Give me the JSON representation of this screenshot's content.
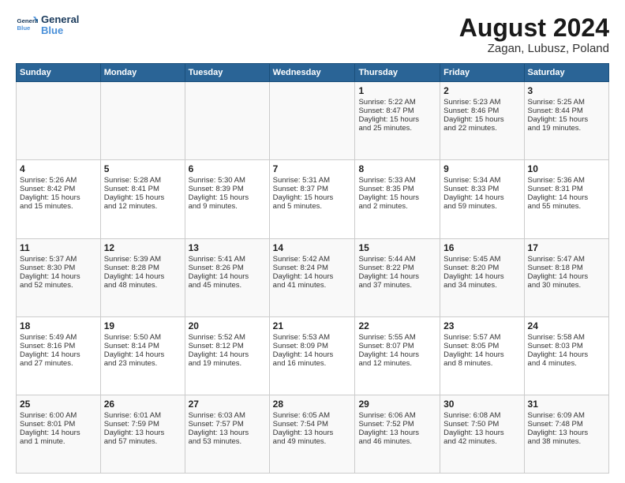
{
  "logo": {
    "line1": "General",
    "line2": "Blue"
  },
  "title": "August 2024",
  "subtitle": "Zagan, Lubusz, Poland",
  "header_days": [
    "Sunday",
    "Monday",
    "Tuesday",
    "Wednesday",
    "Thursday",
    "Friday",
    "Saturday"
  ],
  "weeks": [
    [
      {
        "day": "",
        "info": ""
      },
      {
        "day": "",
        "info": ""
      },
      {
        "day": "",
        "info": ""
      },
      {
        "day": "",
        "info": ""
      },
      {
        "day": "1",
        "info": "Sunrise: 5:22 AM\nSunset: 8:47 PM\nDaylight: 15 hours\nand 25 minutes."
      },
      {
        "day": "2",
        "info": "Sunrise: 5:23 AM\nSunset: 8:46 PM\nDaylight: 15 hours\nand 22 minutes."
      },
      {
        "day": "3",
        "info": "Sunrise: 5:25 AM\nSunset: 8:44 PM\nDaylight: 15 hours\nand 19 minutes."
      }
    ],
    [
      {
        "day": "4",
        "info": "Sunrise: 5:26 AM\nSunset: 8:42 PM\nDaylight: 15 hours\nand 15 minutes."
      },
      {
        "day": "5",
        "info": "Sunrise: 5:28 AM\nSunset: 8:41 PM\nDaylight: 15 hours\nand 12 minutes."
      },
      {
        "day": "6",
        "info": "Sunrise: 5:30 AM\nSunset: 8:39 PM\nDaylight: 15 hours\nand 9 minutes."
      },
      {
        "day": "7",
        "info": "Sunrise: 5:31 AM\nSunset: 8:37 PM\nDaylight: 15 hours\nand 5 minutes."
      },
      {
        "day": "8",
        "info": "Sunrise: 5:33 AM\nSunset: 8:35 PM\nDaylight: 15 hours\nand 2 minutes."
      },
      {
        "day": "9",
        "info": "Sunrise: 5:34 AM\nSunset: 8:33 PM\nDaylight: 14 hours\nand 59 minutes."
      },
      {
        "day": "10",
        "info": "Sunrise: 5:36 AM\nSunset: 8:31 PM\nDaylight: 14 hours\nand 55 minutes."
      }
    ],
    [
      {
        "day": "11",
        "info": "Sunrise: 5:37 AM\nSunset: 8:30 PM\nDaylight: 14 hours\nand 52 minutes."
      },
      {
        "day": "12",
        "info": "Sunrise: 5:39 AM\nSunset: 8:28 PM\nDaylight: 14 hours\nand 48 minutes."
      },
      {
        "day": "13",
        "info": "Sunrise: 5:41 AM\nSunset: 8:26 PM\nDaylight: 14 hours\nand 45 minutes."
      },
      {
        "day": "14",
        "info": "Sunrise: 5:42 AM\nSunset: 8:24 PM\nDaylight: 14 hours\nand 41 minutes."
      },
      {
        "day": "15",
        "info": "Sunrise: 5:44 AM\nSunset: 8:22 PM\nDaylight: 14 hours\nand 37 minutes."
      },
      {
        "day": "16",
        "info": "Sunrise: 5:45 AM\nSunset: 8:20 PM\nDaylight: 14 hours\nand 34 minutes."
      },
      {
        "day": "17",
        "info": "Sunrise: 5:47 AM\nSunset: 8:18 PM\nDaylight: 14 hours\nand 30 minutes."
      }
    ],
    [
      {
        "day": "18",
        "info": "Sunrise: 5:49 AM\nSunset: 8:16 PM\nDaylight: 14 hours\nand 27 minutes."
      },
      {
        "day": "19",
        "info": "Sunrise: 5:50 AM\nSunset: 8:14 PM\nDaylight: 14 hours\nand 23 minutes."
      },
      {
        "day": "20",
        "info": "Sunrise: 5:52 AM\nSunset: 8:12 PM\nDaylight: 14 hours\nand 19 minutes."
      },
      {
        "day": "21",
        "info": "Sunrise: 5:53 AM\nSunset: 8:09 PM\nDaylight: 14 hours\nand 16 minutes."
      },
      {
        "day": "22",
        "info": "Sunrise: 5:55 AM\nSunset: 8:07 PM\nDaylight: 14 hours\nand 12 minutes."
      },
      {
        "day": "23",
        "info": "Sunrise: 5:57 AM\nSunset: 8:05 PM\nDaylight: 14 hours\nand 8 minutes."
      },
      {
        "day": "24",
        "info": "Sunrise: 5:58 AM\nSunset: 8:03 PM\nDaylight: 14 hours\nand 4 minutes."
      }
    ],
    [
      {
        "day": "25",
        "info": "Sunrise: 6:00 AM\nSunset: 8:01 PM\nDaylight: 14 hours\nand 1 minute."
      },
      {
        "day": "26",
        "info": "Sunrise: 6:01 AM\nSunset: 7:59 PM\nDaylight: 13 hours\nand 57 minutes."
      },
      {
        "day": "27",
        "info": "Sunrise: 6:03 AM\nSunset: 7:57 PM\nDaylight: 13 hours\nand 53 minutes."
      },
      {
        "day": "28",
        "info": "Sunrise: 6:05 AM\nSunset: 7:54 PM\nDaylight: 13 hours\nand 49 minutes."
      },
      {
        "day": "29",
        "info": "Sunrise: 6:06 AM\nSunset: 7:52 PM\nDaylight: 13 hours\nand 46 minutes."
      },
      {
        "day": "30",
        "info": "Sunrise: 6:08 AM\nSunset: 7:50 PM\nDaylight: 13 hours\nand 42 minutes."
      },
      {
        "day": "31",
        "info": "Sunrise: 6:09 AM\nSunset: 7:48 PM\nDaylight: 13 hours\nand 38 minutes."
      }
    ]
  ]
}
